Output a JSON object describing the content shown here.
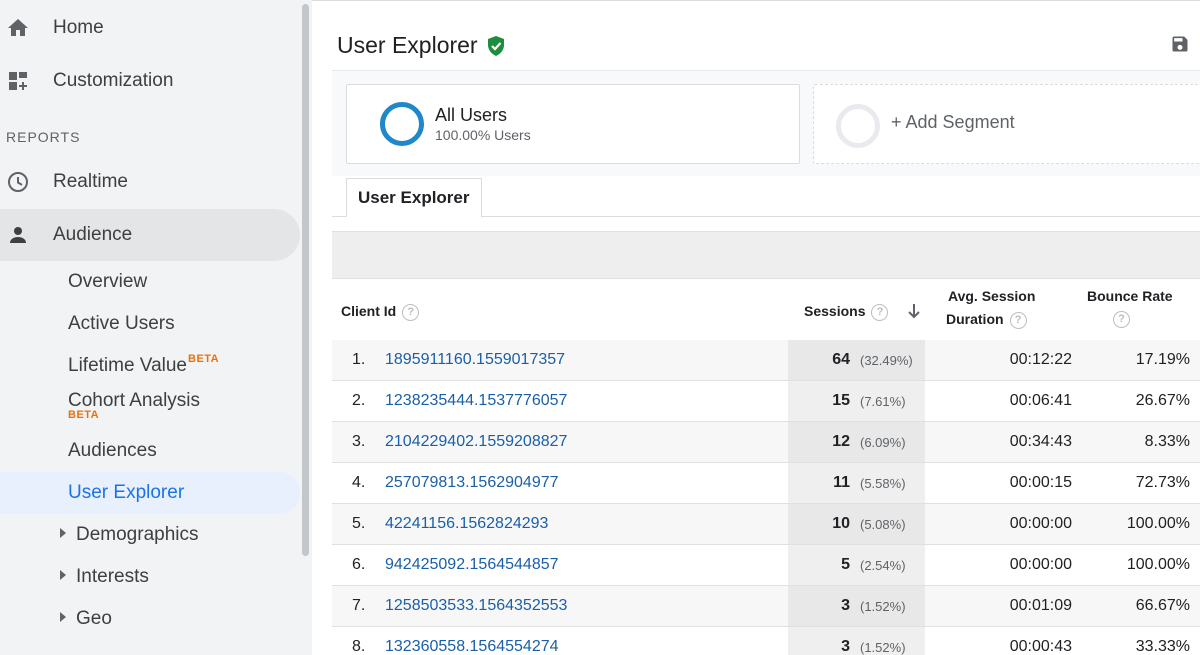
{
  "sidebar": {
    "top_items": [
      {
        "label": "Home",
        "icon": "home-icon"
      },
      {
        "label": "Customization",
        "icon": "dashboard-icon"
      }
    ],
    "section_label": "REPORTS",
    "report_items": [
      {
        "label": "Realtime",
        "icon": "clock-icon"
      },
      {
        "label": "Audience",
        "icon": "person-icon"
      }
    ],
    "audience_sub": {
      "overview": "Overview",
      "active_users": "Active Users",
      "lifetime_value": "Lifetime Value",
      "cohort_analysis": "Cohort Analysis",
      "beta": "BETA",
      "audiences": "Audiences",
      "user_explorer": "User Explorer",
      "demographics": "Demographics",
      "interests": "Interests",
      "geo": "Geo"
    }
  },
  "header": {
    "title": "User Explorer",
    "verified_color": "#1e8e3e"
  },
  "segments": {
    "all_users": {
      "name": "All Users",
      "subtitle": "100.00% Users",
      "ring_color": "#1e88c9"
    },
    "add_segment": "+ Add Segment"
  },
  "tab": {
    "label": "User Explorer"
  },
  "table": {
    "headers": {
      "client_id": "Client Id",
      "sessions": "Sessions",
      "avg_session_1": "Avg. Session",
      "avg_session_2": "Duration",
      "bounce_rate": "Bounce Rate"
    },
    "rows": [
      {
        "num": "1.",
        "client_id": "1895911160.1559017357",
        "sessions": "64",
        "pct": "(32.49%)",
        "duration": "00:12:22",
        "bounce": "17.19%"
      },
      {
        "num": "2.",
        "client_id": "1238235444.1537776057",
        "sessions": "15",
        "pct": "(7.61%)",
        "duration": "00:06:41",
        "bounce": "26.67%"
      },
      {
        "num": "3.",
        "client_id": "2104229402.1559208827",
        "sessions": "12",
        "pct": "(6.09%)",
        "duration": "00:34:43",
        "bounce": "8.33%"
      },
      {
        "num": "4.",
        "client_id": "257079813.1562904977",
        "sessions": "11",
        "pct": "(5.58%)",
        "duration": "00:00:15",
        "bounce": "72.73%"
      },
      {
        "num": "5.",
        "client_id": "42241156.1562824293",
        "sessions": "10",
        "pct": "(5.08%)",
        "duration": "00:00:00",
        "bounce": "100.00%"
      },
      {
        "num": "6.",
        "client_id": "942425092.1564544857",
        "sessions": "5",
        "pct": "(2.54%)",
        "duration": "00:00:00",
        "bounce": "100.00%"
      },
      {
        "num": "7.",
        "client_id": "1258503533.1564352553",
        "sessions": "3",
        "pct": "(1.52%)",
        "duration": "00:01:09",
        "bounce": "66.67%"
      },
      {
        "num": "8.",
        "client_id": "132360558.1564554274",
        "sessions": "3",
        "pct": "(1.52%)",
        "duration": "00:00:43",
        "bounce": "33.33%"
      }
    ]
  }
}
